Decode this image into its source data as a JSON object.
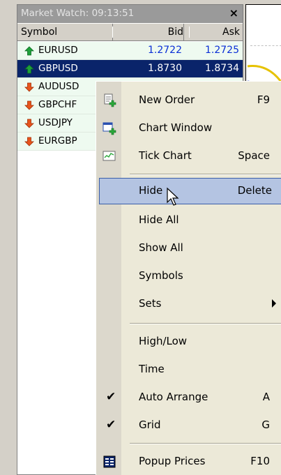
{
  "market_watch": {
    "title": "Market Watch: 09:13:51",
    "close_glyph": "×",
    "columns": {
      "symbol": "Symbol",
      "bid": "Bid",
      "ask": "Ask"
    },
    "rows": [
      {
        "symbol": "EURUSD",
        "bid": "1.2722",
        "ask": "1.2725",
        "direction": "up",
        "selected": false
      },
      {
        "symbol": "GBPUSD",
        "bid": "1.8730",
        "ask": "1.8734",
        "direction": "up",
        "selected": true
      },
      {
        "symbol": "AUDUSD",
        "bid": "",
        "ask": "",
        "direction": "down",
        "selected": false
      },
      {
        "symbol": "GBPCHF",
        "bid": "",
        "ask": "",
        "direction": "down",
        "selected": false
      },
      {
        "symbol": "USDJPY",
        "bid": "",
        "ask": "",
        "direction": "down",
        "selected": false
      },
      {
        "symbol": "EURGBP",
        "bid": "",
        "ask": "",
        "direction": "down",
        "selected": false
      }
    ]
  },
  "context_menu": {
    "items": [
      {
        "label": "New Order",
        "shortcut": "F9",
        "icon": "new-order-icon"
      },
      {
        "label": "Chart Window",
        "shortcut": "",
        "icon": "chart-window-icon"
      },
      {
        "label": "Tick Chart",
        "shortcut": "Space",
        "icon": "tick-chart-icon"
      },
      {
        "label": "Hide",
        "shortcut": "Delete",
        "highlighted": true
      },
      {
        "label": "Hide All",
        "shortcut": ""
      },
      {
        "label": "Show All",
        "shortcut": ""
      },
      {
        "label": "Symbols",
        "shortcut": ""
      },
      {
        "label": "Sets",
        "shortcut": "",
        "submenu": true
      },
      {
        "label": "High/Low",
        "shortcut": ""
      },
      {
        "label": "Time",
        "shortcut": ""
      },
      {
        "label": "Auto Arrange",
        "shortcut": "A",
        "checked": true
      },
      {
        "label": "Grid",
        "shortcut": "G",
        "checked": true
      },
      {
        "label": "Popup Prices",
        "shortcut": "F10",
        "icon": "popup-prices-icon"
      }
    ],
    "check_glyph": "✔"
  },
  "colors": {
    "up_arrow": "#1ea03a",
    "down_arrow": "#e8541c",
    "selection": "#0a246a",
    "menu_highlight": "#b4c4e2",
    "price_text": "#0a2fd6"
  }
}
